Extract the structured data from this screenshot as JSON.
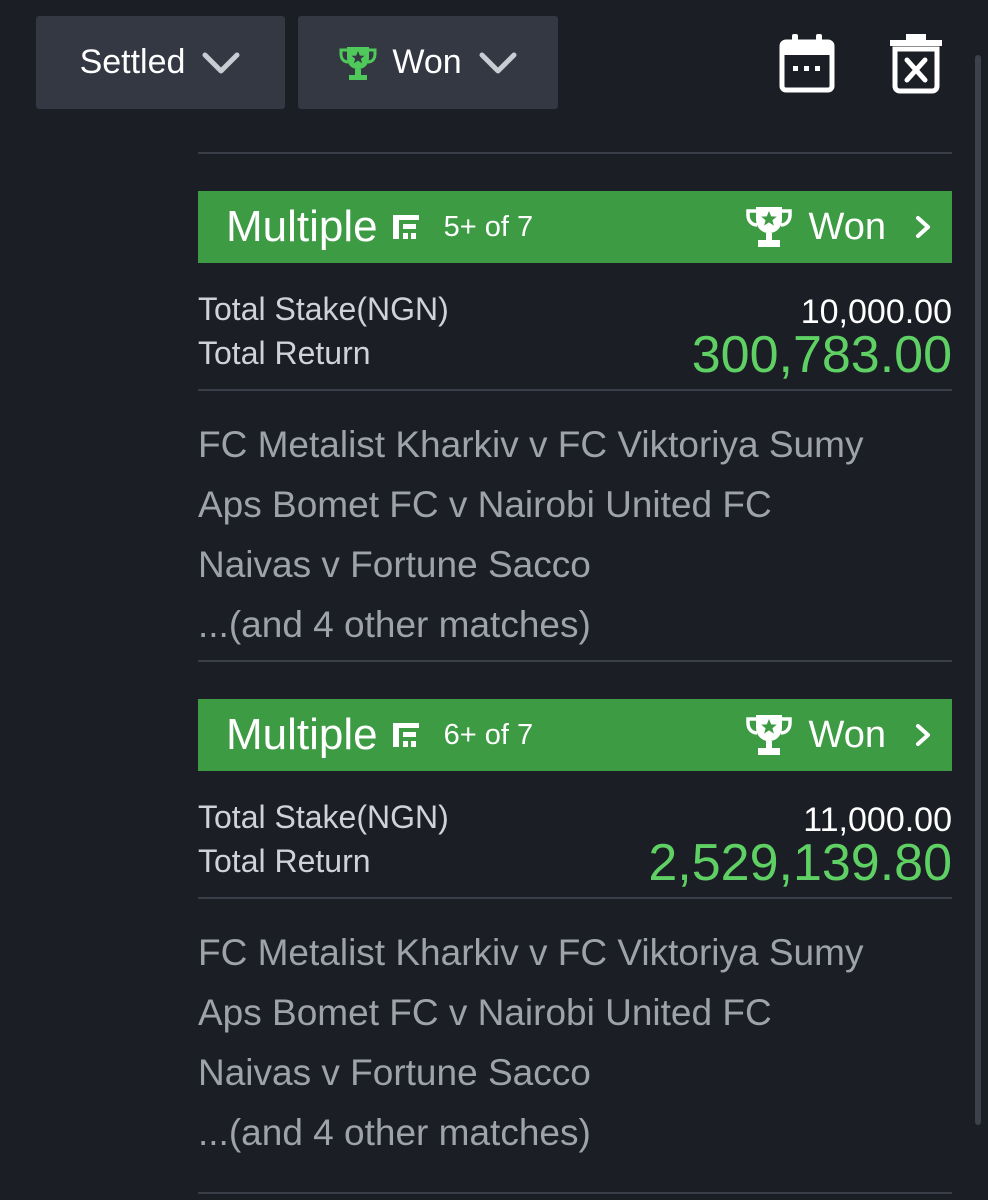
{
  "filters": {
    "status": "Settled",
    "result": "Won"
  },
  "colors": {
    "background": "#1b1e25",
    "header_green": "#3d9b44",
    "return_green": "#5fd064",
    "trophy_green": "#4fc95a",
    "filter_bg": "#343843"
  },
  "icons": [
    "chevron-down-icon",
    "trophy-icon",
    "calendar-icon",
    "trash-icon",
    "chevron-right-icon"
  ],
  "bets": [
    {
      "type": "Multiple",
      "rule": "5+ of 7",
      "status": "Won",
      "stake_label": "Total Stake(NGN)",
      "stake": "10,000.00",
      "return_label": "Total Return",
      "return": "300,783.00",
      "matches": [
        "FC Metalist Kharkiv v FC Viktoriya Sumy",
        "Aps Bomet FC v Nairobi United FC",
        "Naivas v Fortune Sacco",
        "...(and 4 other matches)"
      ]
    },
    {
      "type": "Multiple",
      "rule": "6+ of 7",
      "status": "Won",
      "stake_label": "Total Stake(NGN)",
      "stake": "11,000.00",
      "return_label": "Total Return",
      "return": "2,529,139.80",
      "matches": [
        "FC Metalist Kharkiv v FC Viktoriya Sumy",
        "Aps Bomet FC v Nairobi United FC",
        "Naivas v Fortune Sacco",
        "...(and 4 other matches)"
      ]
    }
  ]
}
